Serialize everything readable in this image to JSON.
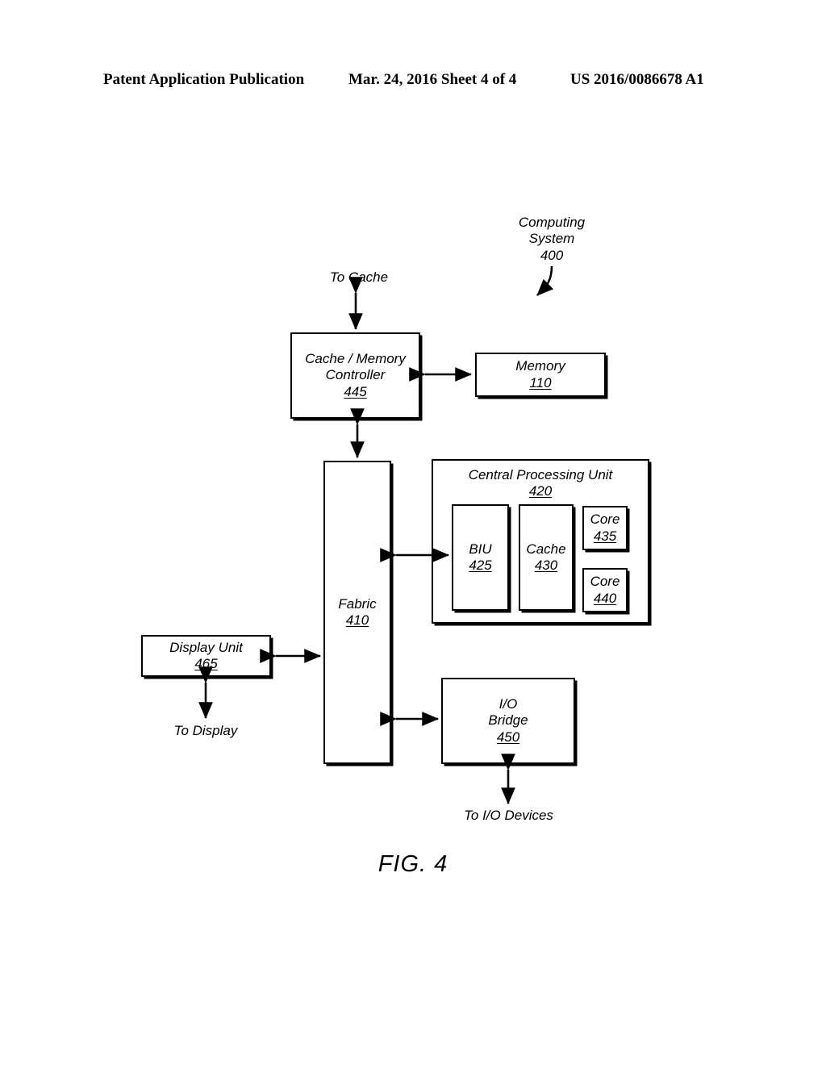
{
  "header": {
    "left": "Patent Application Publication",
    "middle": "Mar. 24, 2016  Sheet 4 of 4",
    "right": "US 2016/0086678 A1"
  },
  "figure": {
    "caption": "FIG. 4",
    "callout": {
      "line1": "Computing",
      "line2": "System",
      "number": "400"
    }
  },
  "blocks": {
    "cache_memory_controller": {
      "line1": "Cache / Memory",
      "line2": "Controller",
      "number": "445"
    },
    "memory": {
      "line1": "Memory",
      "number": "110"
    },
    "fabric": {
      "line1": "Fabric",
      "number": "410"
    },
    "cpu": {
      "line1": "Central Processing Unit",
      "number": "420"
    },
    "biu": {
      "line1": "BIU",
      "number": "425"
    },
    "cpu_cache": {
      "line1": "Cache",
      "number": "430"
    },
    "core_435": {
      "line1": "Core",
      "number": "435"
    },
    "core_440": {
      "line1": "Core",
      "number": "440"
    },
    "display_unit": {
      "line1": "Display Unit",
      "number": "465"
    },
    "io_bridge": {
      "line1": "I/O",
      "line2": "Bridge",
      "number": "450"
    }
  },
  "external_labels": {
    "to_cache": "To Cache",
    "to_display": "To Display",
    "to_io_devices": "To I/O Devices"
  },
  "colors": {
    "ink": "#000000",
    "paper": "#ffffff"
  }
}
